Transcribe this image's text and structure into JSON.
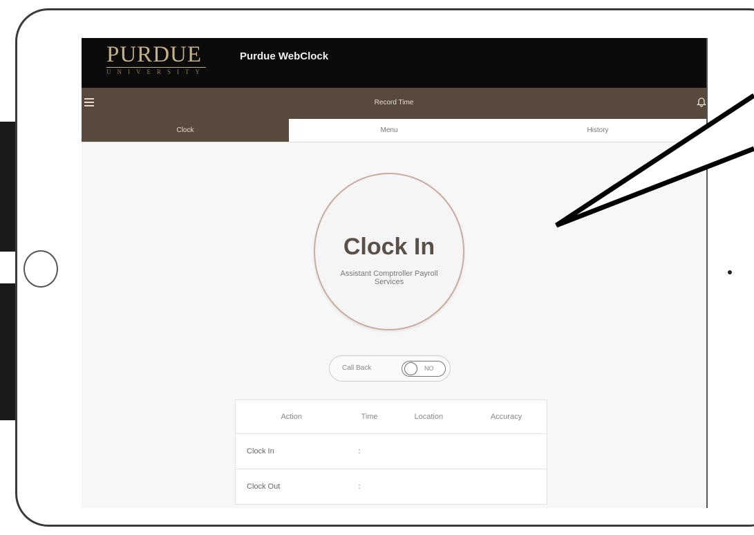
{
  "app": {
    "logo": "PURDUE",
    "logo_sub": "UNIVERSITY",
    "name": "Purdue WebClock"
  },
  "toolbar": {
    "title": "Record Time",
    "menu_icon": "hamburger-menu-icon",
    "bell_icon": "bell-icon"
  },
  "tabs": [
    {
      "label": "Clock"
    },
    {
      "label": "Menu"
    },
    {
      "label": "History"
    }
  ],
  "clock": {
    "title": "Clock In",
    "position": "Assistant Comptroller Payroll Services"
  },
  "callback": {
    "label": "Call Back",
    "toggle_text": "NO"
  },
  "punches": {
    "headers": [
      "Action",
      "Time",
      "Location",
      "Accuracy"
    ],
    "rows": [
      {
        "action": "Clock In",
        "time": ":"
      },
      {
        "action": "Clock Out",
        "time": ":"
      }
    ]
  },
  "colors": {
    "brown": "#574a3d",
    "gold": "#c4b18a",
    "header_black": "#0b0b0b"
  }
}
